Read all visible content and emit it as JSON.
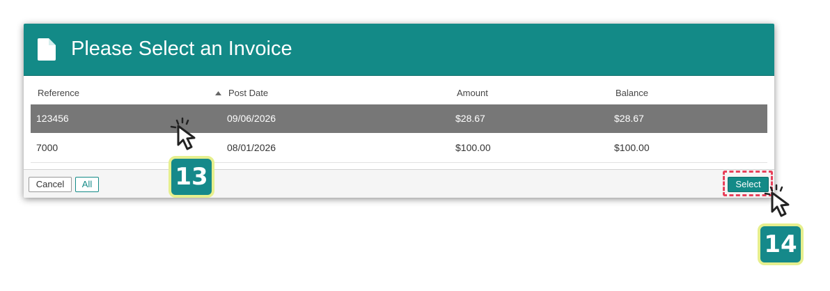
{
  "dialog": {
    "title": "Please Select an Invoice",
    "icon": "document-icon"
  },
  "table": {
    "columns": [
      "Reference",
      "Post Date",
      "Amount",
      "Balance"
    ],
    "sorted_column": "Post Date",
    "sort_direction": "ascending",
    "rows": [
      {
        "reference": "123456",
        "post_date": "09/06/2026",
        "amount": "$28.67",
        "balance": "$28.67",
        "selected": true
      },
      {
        "reference": "7000",
        "post_date": "08/01/2026",
        "amount": "$100.00",
        "balance": "$100.00",
        "selected": false
      }
    ]
  },
  "footer": {
    "cancel_label": "Cancel",
    "all_label": "All",
    "select_label": "Select"
  },
  "annotations": {
    "step_a": "13",
    "step_b": "14"
  },
  "colors": {
    "header": "#138a87",
    "selected_row": "#777777",
    "highlight": "#e8405a",
    "badge_border": "#e6ef8e"
  }
}
